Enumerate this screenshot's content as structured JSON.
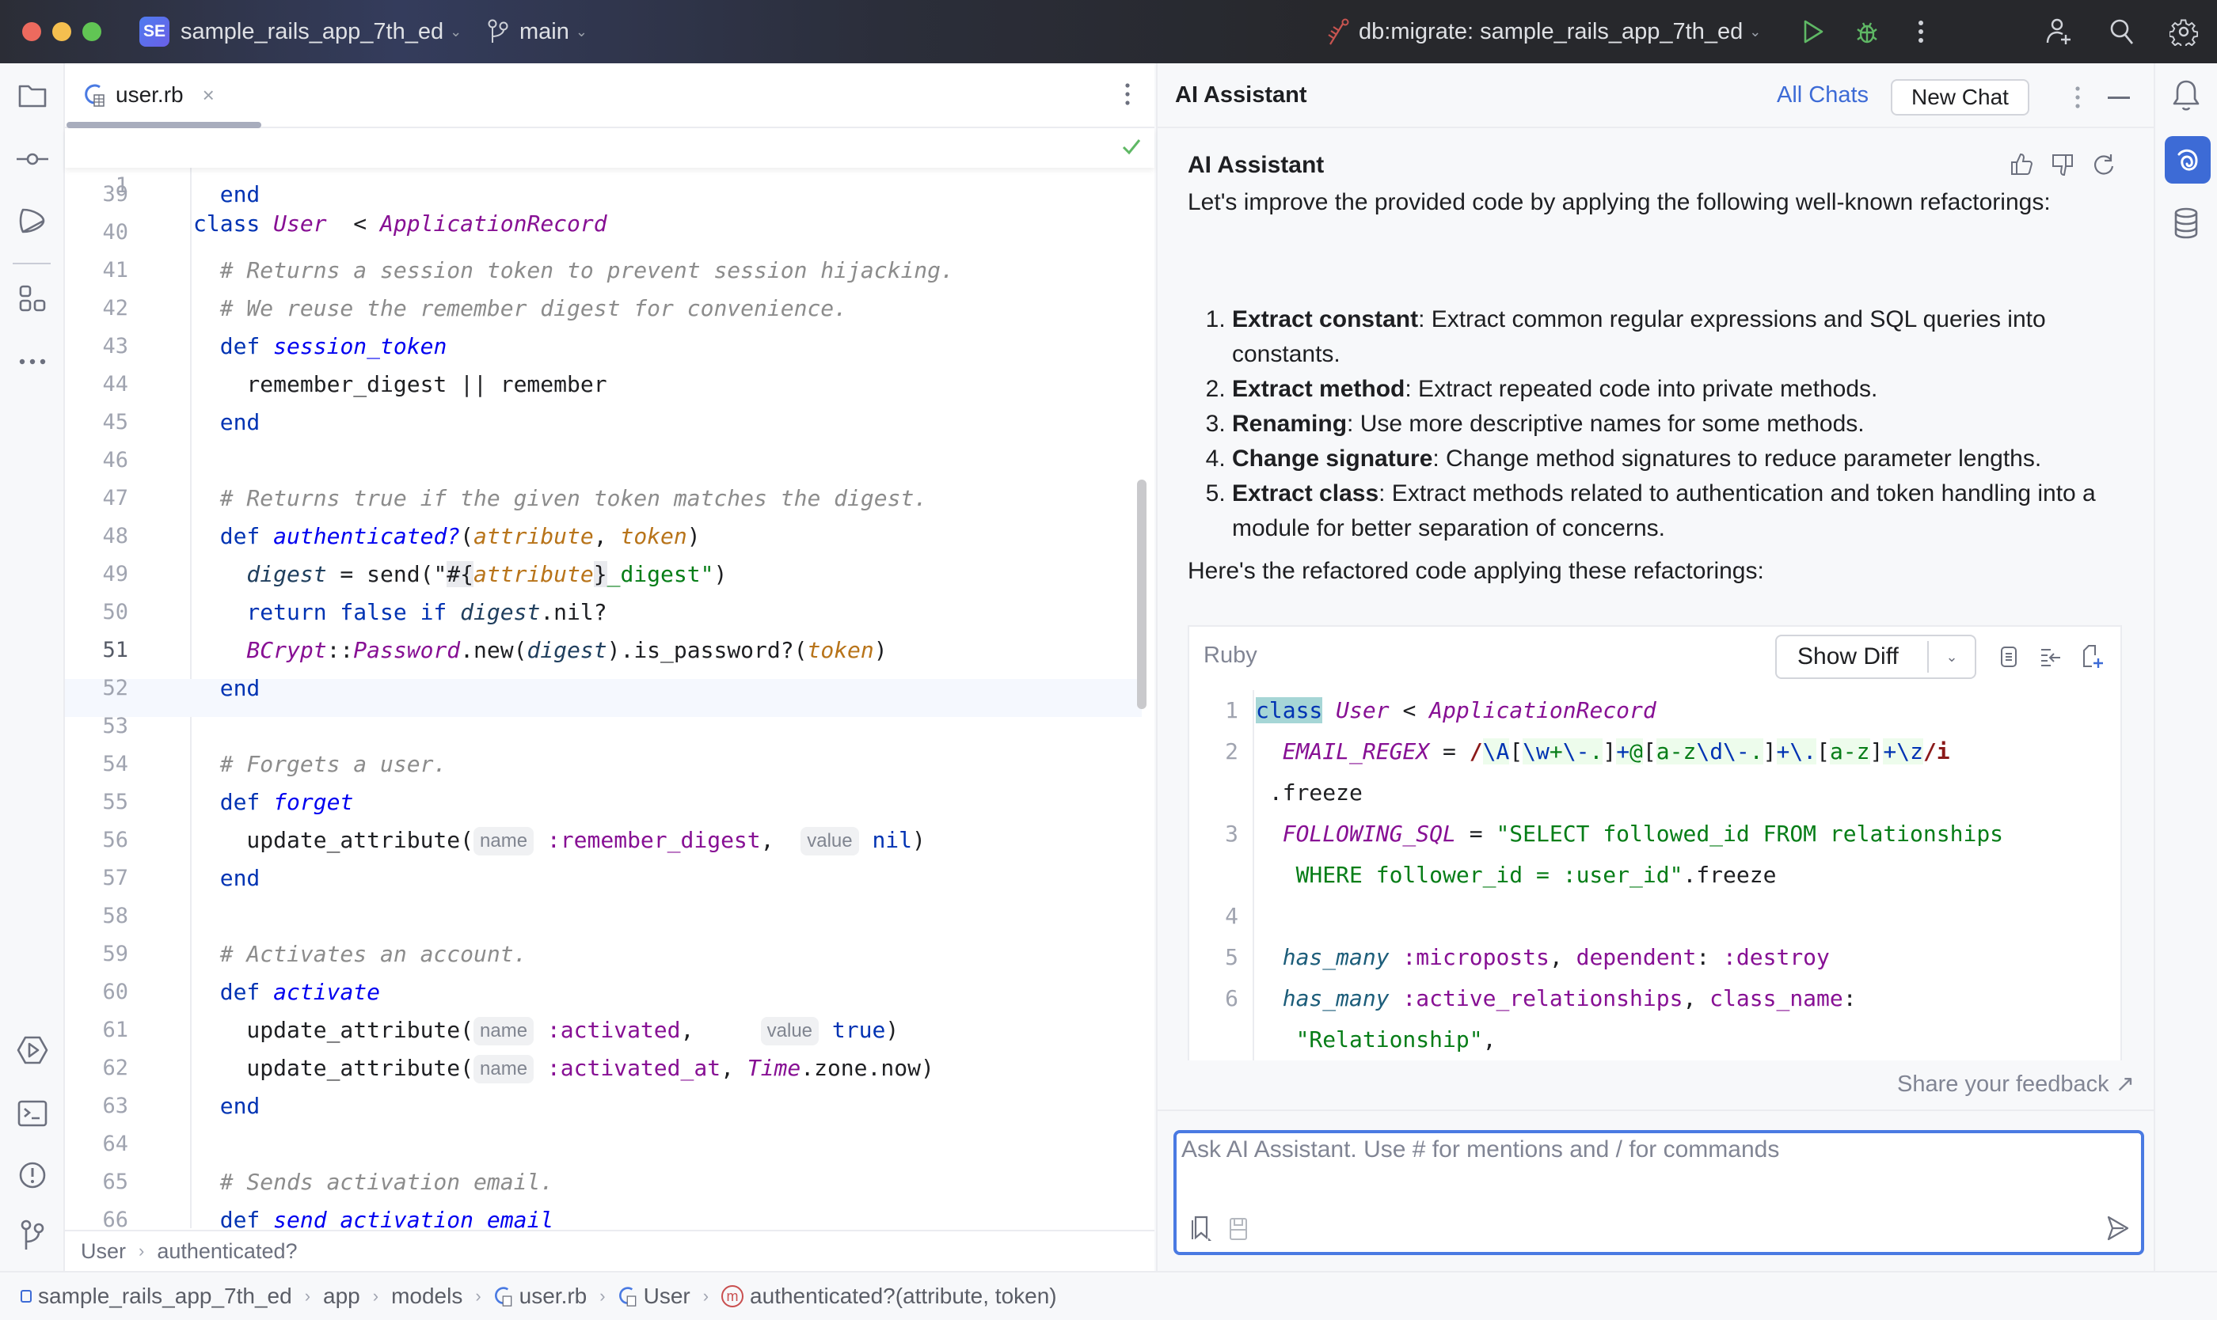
{
  "titlebar": {
    "project_badge": "SE",
    "project_name": "sample_rails_app_7th_ed",
    "branch": "main",
    "run_config": "db:migrate: sample_rails_app_7th_ed",
    "colors": {
      "close": "#ed6a5e",
      "minimize": "#f5bf4f",
      "maximize": "#61c554",
      "run": "#5fb865"
    }
  },
  "left_toolbar": {
    "top_icons": [
      "folder-icon",
      "commit-icon",
      "pull-requests-icon",
      "structure-icon",
      "more-icon"
    ],
    "bottom_icons": [
      "services-icon",
      "terminal-icon",
      "problems-icon",
      "git-icon"
    ]
  },
  "editor": {
    "tab": {
      "filename": "user.rb"
    },
    "sticky_line": {
      "number": "1",
      "tokens": [
        [
          "kw",
          "class "
        ],
        [
          "cls",
          "User"
        ],
        [
          "",
          "  < "
        ],
        [
          "cls",
          "ApplicationRecord"
        ]
      ]
    },
    "current_line": "51",
    "lines": [
      {
        "n": "39",
        "tokens": [
          [
            "kw",
            "  end"
          ]
        ]
      },
      {
        "n": "40",
        "tokens": []
      },
      {
        "n": "41",
        "tokens": [
          [
            "cm",
            "  # Returns a session token to prevent session hijacking."
          ]
        ]
      },
      {
        "n": "42",
        "tokens": [
          [
            "cm",
            "  # We reuse the remember digest for convenience."
          ]
        ]
      },
      {
        "n": "43",
        "tokens": [
          [
            "kw",
            "  def "
          ],
          [
            "fn",
            "session_token"
          ]
        ]
      },
      {
        "n": "44",
        "tokens": [
          [
            "",
            "    remember_digest || remember"
          ]
        ]
      },
      {
        "n": "45",
        "tokens": [
          [
            "kw",
            "  end"
          ]
        ]
      },
      {
        "n": "46",
        "tokens": []
      },
      {
        "n": "47",
        "tokens": [
          [
            "cm",
            "  # Returns true if the given token matches the digest."
          ]
        ]
      },
      {
        "n": "48",
        "tokens": [
          [
            "kw",
            "  def "
          ],
          [
            "fn",
            "authenticated?"
          ],
          [
            "",
            "("
          ],
          [
            "par",
            "attribute"
          ],
          [
            "",
            ", "
          ],
          [
            "par",
            "token"
          ],
          [
            "",
            ")"
          ]
        ]
      },
      {
        "n": "49",
        "tokens": [
          [
            "lv",
            "    digest"
          ],
          [
            "",
            " = send(\""
          ],
          [
            "brc",
            "#{"
          ],
          [
            "par",
            "attribute"
          ],
          [
            "brc",
            "}"
          ],
          [
            "str",
            "_digest"
          ],
          [
            "str",
            "\""
          ],
          [
            "",
            ")"
          ]
        ]
      },
      {
        "n": "50",
        "tokens": [
          [
            "kw",
            "    return false if "
          ],
          [
            "lv",
            "digest"
          ],
          [
            "",
            ".nil?"
          ]
        ]
      },
      {
        "n": "51",
        "tokens": [
          [
            "cls",
            "    BCrypt"
          ],
          [
            "",
            "::"
          ],
          [
            "cls",
            "Password"
          ],
          [
            "",
            ".new("
          ],
          [
            "lv",
            "digest"
          ],
          [
            "",
            ").is_password?("
          ],
          [
            "par",
            "token"
          ],
          [
            "",
            ")"
          ]
        ]
      },
      {
        "n": "52",
        "tokens": [
          [
            "kw",
            "  end"
          ]
        ]
      },
      {
        "n": "53",
        "tokens": []
      },
      {
        "n": "54",
        "tokens": [
          [
            "cm",
            "  # Forgets a user."
          ]
        ]
      },
      {
        "n": "55",
        "tokens": [
          [
            "kw",
            "  def "
          ],
          [
            "fn",
            "forget"
          ]
        ]
      },
      {
        "n": "56",
        "tokens": [
          [
            "",
            "    update_attribute("
          ],
          [
            "hint",
            "name"
          ],
          [
            "sym",
            " :remember_digest"
          ],
          [
            "",
            ",  "
          ],
          [
            "hint",
            "value"
          ],
          [
            "kw",
            " nil"
          ],
          [
            "",
            ")"
          ]
        ]
      },
      {
        "n": "57",
        "tokens": [
          [
            "kw",
            "  end"
          ]
        ]
      },
      {
        "n": "58",
        "tokens": []
      },
      {
        "n": "59",
        "tokens": [
          [
            "cm",
            "  # Activates an account."
          ]
        ]
      },
      {
        "n": "60",
        "tokens": [
          [
            "kw",
            "  def "
          ],
          [
            "fn",
            "activate"
          ]
        ]
      },
      {
        "n": "61",
        "tokens": [
          [
            "",
            "    update_attribute("
          ],
          [
            "hint",
            "name"
          ],
          [
            "sym",
            " :activated"
          ],
          [
            "",
            ",     "
          ],
          [
            "hint",
            "value"
          ],
          [
            "kw",
            " true"
          ],
          [
            "",
            ")"
          ]
        ]
      },
      {
        "n": "62",
        "tokens": [
          [
            "",
            "    update_attribute("
          ],
          [
            "hint",
            "name"
          ],
          [
            "sym",
            " :activated_at"
          ],
          [
            "",
            ", "
          ],
          [
            "cls",
            "Time"
          ],
          [
            "",
            ".zone.now)"
          ]
        ]
      },
      {
        "n": "63",
        "tokens": [
          [
            "kw",
            "  end"
          ]
        ]
      },
      {
        "n": "64",
        "tokens": []
      },
      {
        "n": "65",
        "tokens": [
          [
            "cm",
            "  # Sends activation email."
          ]
        ]
      },
      {
        "n": "66",
        "tokens": [
          [
            "kw",
            "  def "
          ],
          [
            "fn",
            "send_activation_email"
          ]
        ]
      }
    ],
    "breadcrumb": [
      "User",
      "authenticated?"
    ]
  },
  "ai_panel": {
    "title": "AI Assistant",
    "all_chats": "All Chats",
    "new_chat": "New Chat",
    "message": {
      "author": "AI Assistant",
      "intro": "Let's improve the provided code by applying the following well-known refactorings:",
      "items": [
        {
          "term": "Extract constant",
          "text": ": Extract common regular expressions and SQL queries into constants."
        },
        {
          "term": "Extract method",
          "text": ": Extract repeated code into private methods."
        },
        {
          "term": "Renaming",
          "text": ": Use more descriptive names for some methods."
        },
        {
          "term": "Change signature",
          "text": ": Change method signatures to reduce parameter lengths."
        },
        {
          "term": "Extract class",
          "text": ": Extract methods related to authentication and token handling into a module for better separation of concerns."
        }
      ],
      "outro": "Here's the refactored code applying these refactorings:"
    },
    "code_block": {
      "language": "Ruby",
      "show_diff": "Show Diff",
      "lines": [
        {
          "n": "1",
          "tokens": [
            [
              "sel",
              "class"
            ],
            [
              "",
              " "
            ],
            [
              "cls",
              "User"
            ],
            [
              "",
              " < "
            ],
            [
              "cls",
              "ApplicationRecord"
            ]
          ]
        },
        {
          "n": "2",
          "tokens": [
            [
              "cls",
              "  EMAIL_REGEX"
            ],
            [
              "",
              " = "
            ],
            [
              "rxd",
              "/"
            ],
            [
              "rx",
              "\\A"
            ],
            [
              "",
              "["
            ],
            [
              "rx",
              "\\w"
            ],
            [
              "rxg",
              "+"
            ],
            [
              "rx",
              "\\-"
            ],
            [
              "rxg",
              "."
            ],
            [
              "",
              "]"
            ],
            [
              "rx",
              "+"
            ],
            [
              "rxg",
              "@"
            ],
            [
              "",
              "["
            ],
            [
              "rxg",
              "a-z"
            ],
            [
              "rx",
              "\\d\\-"
            ],
            [
              "rxg",
              "."
            ],
            [
              "",
              "]"
            ],
            [
              "rx",
              "+\\."
            ],
            [
              "",
              "["
            ],
            [
              "rxg",
              "a-z"
            ],
            [
              "",
              "]"
            ],
            [
              "rx",
              "+\\z"
            ],
            [
              "rxd",
              "/i"
            ]
          ]
        },
        {
          "n": "",
          "tokens": [
            [
              "",
              " .freeze"
            ]
          ]
        },
        {
          "n": "3",
          "tokens": [
            [
              "cls",
              "  FOLLOWING_SQL"
            ],
            [
              "",
              " = "
            ],
            [
              "str",
              "\"SELECT followed_id FROM relationships"
            ]
          ]
        },
        {
          "n": "",
          "tokens": [
            [
              "str",
              "   WHERE follower_id = :user_id\""
            ],
            [
              "",
              ".freeze"
            ]
          ]
        },
        {
          "n": "4",
          "tokens": []
        },
        {
          "n": "5",
          "tokens": [
            [
              "hm",
              "  has_many"
            ],
            [
              "sym",
              " :microposts"
            ],
            [
              "",
              ", "
            ],
            [
              "sym",
              "dependent"
            ],
            [
              "",
              ": "
            ],
            [
              "sym",
              ":destroy"
            ]
          ]
        },
        {
          "n": "6",
          "tokens": [
            [
              "hm",
              "  has_many"
            ],
            [
              "sym",
              " :active_relationships"
            ],
            [
              "",
              ", "
            ],
            [
              "sym",
              "class_name"
            ],
            [
              "",
              ":"
            ]
          ]
        },
        {
          "n": "",
          "tokens": [
            [
              "str",
              "   \"Relationship\""
            ],
            [
              "",
              ","
            ]
          ]
        }
      ]
    },
    "feedback_link": "Share your feedback ↗",
    "input_placeholder": "Ask AI Assistant. Use # for mentions and / for commands",
    "input_value": ""
  },
  "right_toolbar": {
    "icons": [
      "notifications-icon",
      "ai-assistant-icon",
      "database-icon"
    ]
  },
  "statusbar": {
    "breadcrumb": [
      "sample_rails_app_7th_ed",
      "app",
      "models",
      "user.rb",
      "User",
      "authenticated?(attribute, token)"
    ]
  }
}
